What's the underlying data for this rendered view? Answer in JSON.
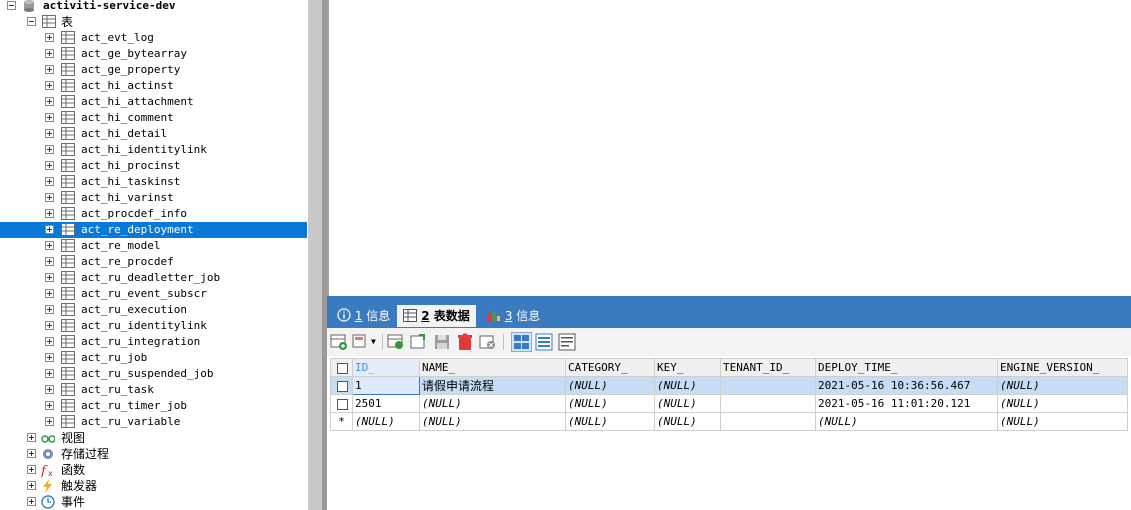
{
  "tree": {
    "database": "activiti-service-dev",
    "tables_label": "表",
    "tables": [
      "act_evt_log",
      "act_ge_bytearray",
      "act_ge_property",
      "act_hi_actinst",
      "act_hi_attachment",
      "act_hi_comment",
      "act_hi_detail",
      "act_hi_identitylink",
      "act_hi_procinst",
      "act_hi_taskinst",
      "act_hi_varinst",
      "act_procdef_info",
      "act_re_deployment",
      "act_re_model",
      "act_re_procdef",
      "act_ru_deadletter_job",
      "act_ru_event_subscr",
      "act_ru_execution",
      "act_ru_identitylink",
      "act_ru_integration",
      "act_ru_job",
      "act_ru_suspended_job",
      "act_ru_task",
      "act_ru_timer_job",
      "act_ru_variable"
    ],
    "selected_table": "act_re_deployment",
    "other_nodes": [
      {
        "label": "视图",
        "icon": "view-icon"
      },
      {
        "label": "存储过程",
        "icon": "gear-icon"
      },
      {
        "label": "函数",
        "icon": "function-icon"
      },
      {
        "label": "触发器",
        "icon": "trigger-icon"
      },
      {
        "label": "事件",
        "icon": "clock-icon"
      }
    ]
  },
  "tabs": [
    {
      "num": "1",
      "label": "信息",
      "icon": "info-icon"
    },
    {
      "num": "2",
      "label": "表数据",
      "icon": "table-icon",
      "active": true
    },
    {
      "num": "3",
      "label": "信息",
      "icon": "chart-icon"
    }
  ],
  "grid": {
    "columns": [
      "ID_",
      "NAME_",
      "CATEGORY_",
      "KEY_",
      "TENANT_ID_",
      "DEPLOY_TIME_",
      "ENGINE_VERSION_"
    ],
    "rows": [
      [
        "1",
        "请假申请流程",
        "(NULL)",
        "(NULL)",
        "",
        "2021-05-16 10:36:56.467",
        "(NULL)"
      ],
      [
        "2501",
        "(NULL)",
        "(NULL)",
        "(NULL)",
        "",
        "2021-05-16 11:01:20.121",
        "(NULL)"
      ],
      [
        "(NULL)",
        "(NULL)",
        "(NULL)",
        "(NULL)",
        "",
        "(NULL)",
        "(NULL)"
      ]
    ],
    "new_row_marker": "*"
  },
  "colors": {
    "selection": "#0a78d7",
    "tabbar": "#3a7bbf",
    "row_selected": "#c6ddf5"
  }
}
